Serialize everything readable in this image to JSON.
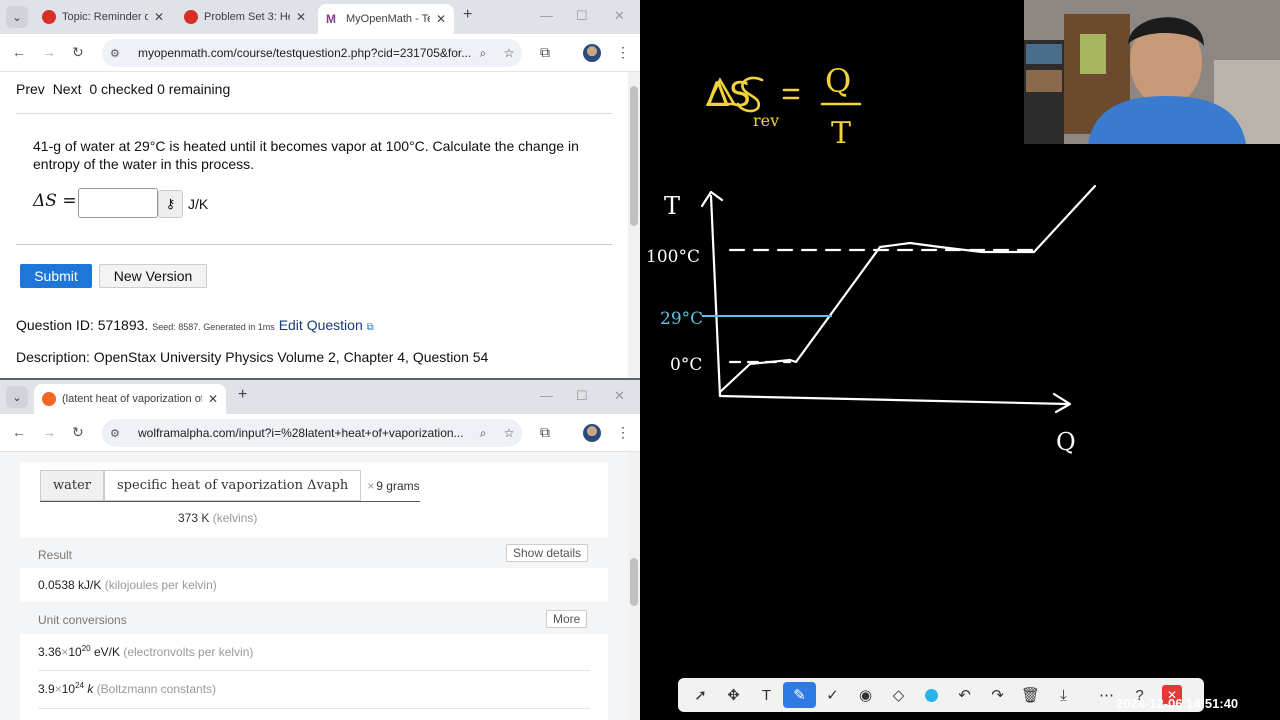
{
  "top_browser": {
    "tabs": [
      {
        "title": "Topic: Reminder of",
        "favicon_color": "#d93025"
      },
      {
        "title": "Problem Set 3: He",
        "favicon_color": "#d93025"
      },
      {
        "title": "MyOpenMath - Te",
        "favicon_color": "#8a3c8c"
      }
    ],
    "url": "myopenmath.com/course/testquestion2.php?cid=231705&for..."
  },
  "myopenmath": {
    "nav": {
      "prev": "Prev",
      "next": "Next",
      "status": "0 checked 0 remaining"
    },
    "question_text": "41-g of water at 29°C is heated until it becomes vapor at 100°C. Calculate the change in entropy of the water in this process.",
    "answer_label": "ΔS =",
    "answer_value": "",
    "unit": "J/K",
    "submit_label": "Submit",
    "new_version_label": "New Version",
    "question_id_label": "Question ID: 571893.",
    "seed_text": "Seed: 8587. Generated in 1ms",
    "edit_question_label": "Edit Question",
    "description": "Description: OpenStax University Physics Volume 2, Chapter 4, Question 54"
  },
  "bottom_browser": {
    "tab_title": "(latent heat of vaporization of v",
    "url": "wolframalpha.com/input?i=%28latent+heat+of+vaporization..."
  },
  "wolfram": {
    "interp_water": "water",
    "interp_quantity": "specific heat of vaporization Δvaph",
    "interp_times": "×",
    "interp_grams": "9 grams",
    "kelvin_value": "373 K",
    "kelvin_unit": "(kelvins)",
    "result_label": "Result",
    "show_details_label": "Show details",
    "result_value": "0.0538 kJ/K",
    "result_unit": "(kilojoules per kelvin)",
    "unit_conv_label": "Unit conversions",
    "more_label": "More",
    "conv1_mant": "3.36",
    "conv1_exp": "20",
    "conv1_unit": "eV/K",
    "conv1_desc": "(electronvolts per kelvin)",
    "conv2_mant": "3.9",
    "conv2_exp": "24",
    "conv2_unit": "k",
    "conv2_desc": "(Boltzmann constants)"
  },
  "whiteboard": {
    "formula_lhs": "ΔS",
    "formula_sub": "rev",
    "formula_num": "Q",
    "formula_den": "T",
    "axis_t": "T",
    "axis_q": "Q",
    "label_100": "100°C",
    "label_29": "29°C",
    "label_0": "0°C",
    "ink_color": "#f2d33a",
    "highlight_color": "#5bc3e6"
  },
  "toolbar": {
    "tools": [
      "select-icon",
      "move-icon",
      "text-icon",
      "pen-icon",
      "check-icon",
      "laser-icon",
      "eraser-icon",
      "color-dot",
      "undo-icon",
      "redo-icon",
      "trash-icon",
      "download-icon"
    ],
    "timestamp": "2024-12-06  14:51:40"
  }
}
